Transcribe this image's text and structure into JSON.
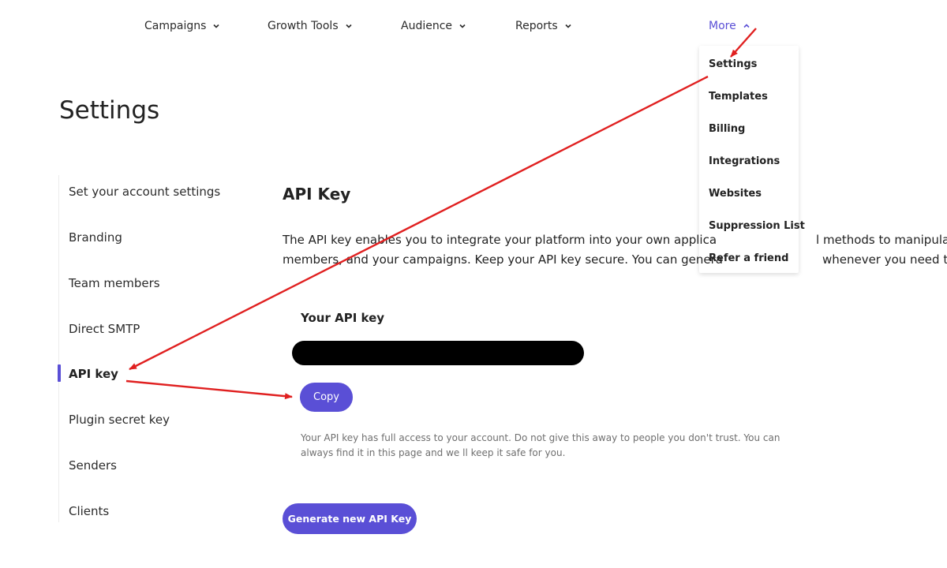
{
  "nav": {
    "items": [
      {
        "label": "Campaigns",
        "chevron": "down"
      },
      {
        "label": "Growth Tools",
        "chevron": "down"
      },
      {
        "label": "Audience",
        "chevron": "down"
      },
      {
        "label": "Reports",
        "chevron": "down"
      },
      {
        "label": "More",
        "chevron": "up",
        "active": true
      }
    ]
  },
  "dropdown": {
    "items": [
      "Settings",
      "Templates",
      "Billing",
      "Integrations",
      "Websites",
      "Suppression List",
      "Refer a friend"
    ]
  },
  "page": {
    "title": "Settings"
  },
  "sidebar": {
    "items": [
      {
        "label": "Set your account settings"
      },
      {
        "label": "Branding"
      },
      {
        "label": "Team members"
      },
      {
        "label": "Direct SMTP"
      },
      {
        "label": "API key",
        "active": true
      },
      {
        "label": "Plugin secret key"
      },
      {
        "label": "Senders"
      },
      {
        "label": "Clients"
      }
    ]
  },
  "main": {
    "section_title": "API Key",
    "description_line1": "The API key enables you to integrate your platform into your own applica",
    "description_line1_tail": "l methods to manipulate y",
    "description_line2": "members, and your campaigns. Keep your API key secure. You can genera",
    "description_line2_tail": "whenever you need to.",
    "key_label": "Your API key",
    "copy_label": "Copy",
    "warning": "Your API key has full access to your account. Do not give this away to people you don't trust. You can always find it in this page and we ll keep it safe for you.",
    "generate_label": "Generate new API Key"
  },
  "colors": {
    "accent": "#5a4fd6",
    "annotation": "#e02020",
    "redacted": "#000000"
  },
  "icons": {
    "chevron": "chevron-icon"
  }
}
